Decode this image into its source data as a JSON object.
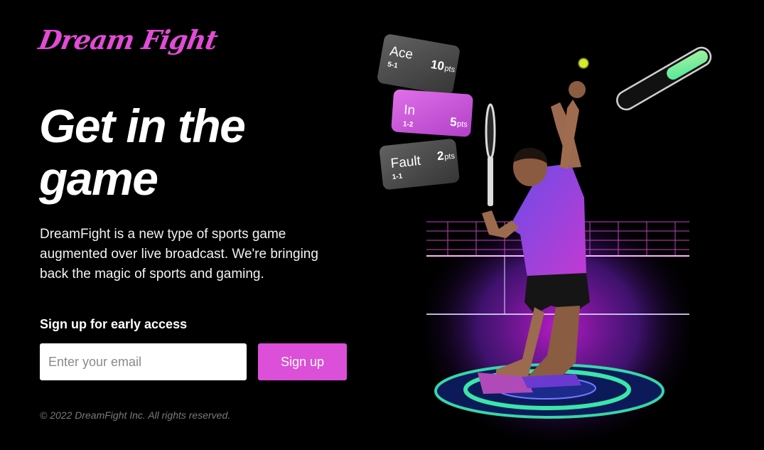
{
  "brand": {
    "logo_text": "Dream Fight"
  },
  "hero": {
    "headline": "Get in the game",
    "description": "DreamFight is a new type of sports game augmented over live broadcast. We're bringing back the magic of sports and gaming."
  },
  "signup": {
    "label": "Sign up for early access",
    "email_placeholder": "Enter your email",
    "button_label": "Sign up"
  },
  "footer": {
    "copyright": "© 2022 DreamFight Inc. All rights reserved."
  },
  "score_cards": [
    {
      "title": "Ace",
      "sub": "5-1",
      "points": "10",
      "unit": "pts"
    },
    {
      "title": "In",
      "sub": "1-2",
      "points": "5",
      "unit": "pts"
    },
    {
      "title": "Fault",
      "sub": "1-1",
      "points": "2",
      "unit": "pts"
    }
  ],
  "colors": {
    "accent": "#dc4fd8",
    "logo": "#e24bd6",
    "meter_green": "#4ee99a",
    "background": "#000000"
  }
}
